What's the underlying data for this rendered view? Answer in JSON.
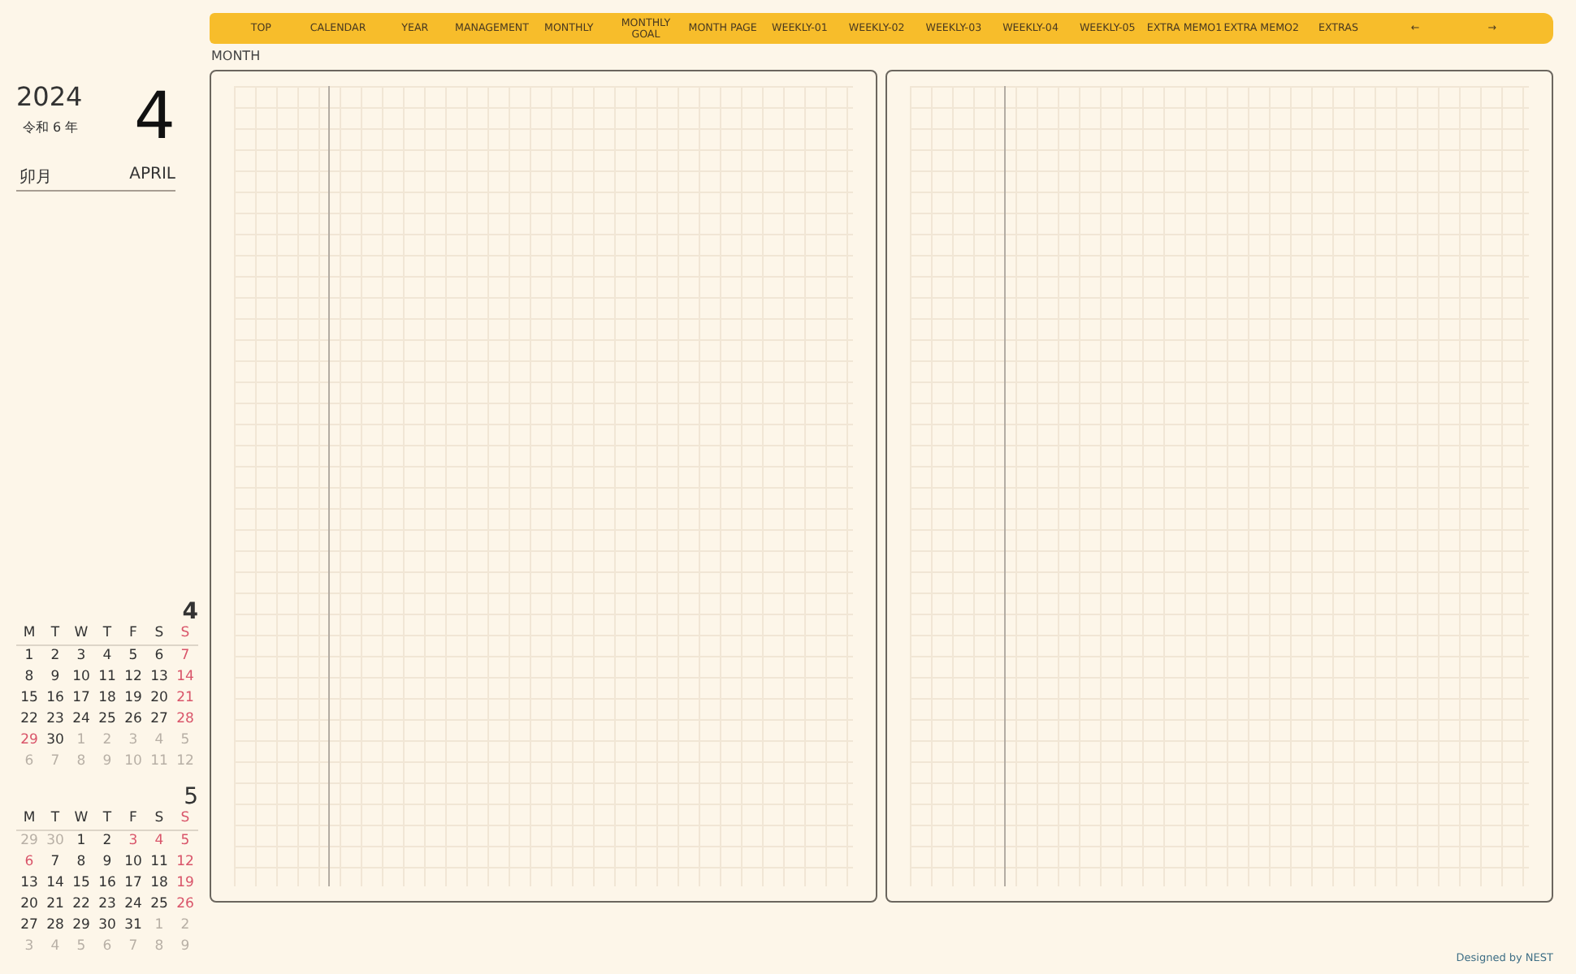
{
  "sidebar": {
    "year": "2024",
    "era": "令和 6 年",
    "month_number": "4",
    "month_jp": "卯月",
    "month_en": "APRIL",
    "calendars": [
      {
        "month": "4",
        "weekdays": [
          {
            "label": "M",
            "kind": "day"
          },
          {
            "label": "T",
            "kind": "day"
          },
          {
            "label": "W",
            "kind": "day"
          },
          {
            "label": "T",
            "kind": "day"
          },
          {
            "label": "F",
            "kind": "day"
          },
          {
            "label": "S",
            "kind": "day"
          },
          {
            "label": "S",
            "kind": "holiday"
          }
        ],
        "weeks": [
          [
            {
              "d": "1",
              "kind": "day"
            },
            {
              "d": "2",
              "kind": "day"
            },
            {
              "d": "3",
              "kind": "day"
            },
            {
              "d": "4",
              "kind": "day"
            },
            {
              "d": "5",
              "kind": "day"
            },
            {
              "d": "6",
              "kind": "day"
            },
            {
              "d": "7",
              "kind": "holiday"
            }
          ],
          [
            {
              "d": "8",
              "kind": "day"
            },
            {
              "d": "9",
              "kind": "day"
            },
            {
              "d": "10",
              "kind": "day"
            },
            {
              "d": "11",
              "kind": "day"
            },
            {
              "d": "12",
              "kind": "day"
            },
            {
              "d": "13",
              "kind": "day"
            },
            {
              "d": "14",
              "kind": "holiday"
            }
          ],
          [
            {
              "d": "15",
              "kind": "day"
            },
            {
              "d": "16",
              "kind": "day"
            },
            {
              "d": "17",
              "kind": "day"
            },
            {
              "d": "18",
              "kind": "day"
            },
            {
              "d": "19",
              "kind": "day"
            },
            {
              "d": "20",
              "kind": "day"
            },
            {
              "d": "21",
              "kind": "holiday"
            }
          ],
          [
            {
              "d": "22",
              "kind": "day"
            },
            {
              "d": "23",
              "kind": "day"
            },
            {
              "d": "24",
              "kind": "day"
            },
            {
              "d": "25",
              "kind": "day"
            },
            {
              "d": "26",
              "kind": "day"
            },
            {
              "d": "27",
              "kind": "day"
            },
            {
              "d": "28",
              "kind": "holiday"
            }
          ],
          [
            {
              "d": "29",
              "kind": "holiday"
            },
            {
              "d": "30",
              "kind": "day"
            },
            {
              "d": "1",
              "kind": "other"
            },
            {
              "d": "2",
              "kind": "other"
            },
            {
              "d": "3",
              "kind": "other"
            },
            {
              "d": "4",
              "kind": "other"
            },
            {
              "d": "5",
              "kind": "other"
            }
          ],
          [
            {
              "d": "6",
              "kind": "other"
            },
            {
              "d": "7",
              "kind": "other"
            },
            {
              "d": "8",
              "kind": "other"
            },
            {
              "d": "9",
              "kind": "other"
            },
            {
              "d": "10",
              "kind": "other"
            },
            {
              "d": "11",
              "kind": "other"
            },
            {
              "d": "12",
              "kind": "other"
            }
          ]
        ]
      },
      {
        "month": "5",
        "weekdays": [
          {
            "label": "M",
            "kind": "day"
          },
          {
            "label": "T",
            "kind": "day"
          },
          {
            "label": "W",
            "kind": "day"
          },
          {
            "label": "T",
            "kind": "day"
          },
          {
            "label": "F",
            "kind": "day"
          },
          {
            "label": "S",
            "kind": "day"
          },
          {
            "label": "S",
            "kind": "holiday"
          }
        ],
        "weeks": [
          [
            {
              "d": "29",
              "kind": "other"
            },
            {
              "d": "30",
              "kind": "other"
            },
            {
              "d": "1",
              "kind": "day"
            },
            {
              "d": "2",
              "kind": "day"
            },
            {
              "d": "3",
              "kind": "holiday"
            },
            {
              "d": "4",
              "kind": "holiday"
            },
            {
              "d": "5",
              "kind": "holiday"
            }
          ],
          [
            {
              "d": "6",
              "kind": "holiday"
            },
            {
              "d": "7",
              "kind": "day"
            },
            {
              "d": "8",
              "kind": "day"
            },
            {
              "d": "9",
              "kind": "day"
            },
            {
              "d": "10",
              "kind": "day"
            },
            {
              "d": "11",
              "kind": "day"
            },
            {
              "d": "12",
              "kind": "holiday"
            }
          ],
          [
            {
              "d": "13",
              "kind": "day"
            },
            {
              "d": "14",
              "kind": "day"
            },
            {
              "d": "15",
              "kind": "day"
            },
            {
              "d": "16",
              "kind": "day"
            },
            {
              "d": "17",
              "kind": "day"
            },
            {
              "d": "18",
              "kind": "day"
            },
            {
              "d": "19",
              "kind": "holiday"
            }
          ],
          [
            {
              "d": "20",
              "kind": "day"
            },
            {
              "d": "21",
              "kind": "day"
            },
            {
              "d": "22",
              "kind": "day"
            },
            {
              "d": "23",
              "kind": "day"
            },
            {
              "d": "24",
              "kind": "day"
            },
            {
              "d": "25",
              "kind": "day"
            },
            {
              "d": "26",
              "kind": "holiday"
            }
          ],
          [
            {
              "d": "27",
              "kind": "day"
            },
            {
              "d": "28",
              "kind": "day"
            },
            {
              "d": "29",
              "kind": "day"
            },
            {
              "d": "30",
              "kind": "day"
            },
            {
              "d": "31",
              "kind": "day"
            },
            {
              "d": "1",
              "kind": "other"
            },
            {
              "d": "2",
              "kind": "other"
            }
          ],
          [
            {
              "d": "3",
              "kind": "other"
            },
            {
              "d": "4",
              "kind": "other"
            },
            {
              "d": "5",
              "kind": "other"
            },
            {
              "d": "6",
              "kind": "other"
            },
            {
              "d": "7",
              "kind": "other"
            },
            {
              "d": "8",
              "kind": "other"
            },
            {
              "d": "9",
              "kind": "other"
            }
          ]
        ]
      }
    ]
  },
  "nav": [
    "TOP",
    "CALENDAR",
    "YEAR",
    "MANAGEMENT",
    "MONTHLY",
    "MONTHLY GOAL",
    "MONTH PAGE",
    "WEEKLY-01",
    "WEEKLY-02",
    "WEEKLY-03",
    "WEEKLY-04",
    "WEEKLY-05",
    "EXTRA MEMO1",
    "EXTRA MEMO2",
    "EXTRAS",
    "←",
    "→"
  ],
  "section_label": "MONTH",
  "pages": [
    {
      "kind": "grid"
    },
    {
      "kind": "grid"
    }
  ],
  "credit": "Designed by NEST"
}
